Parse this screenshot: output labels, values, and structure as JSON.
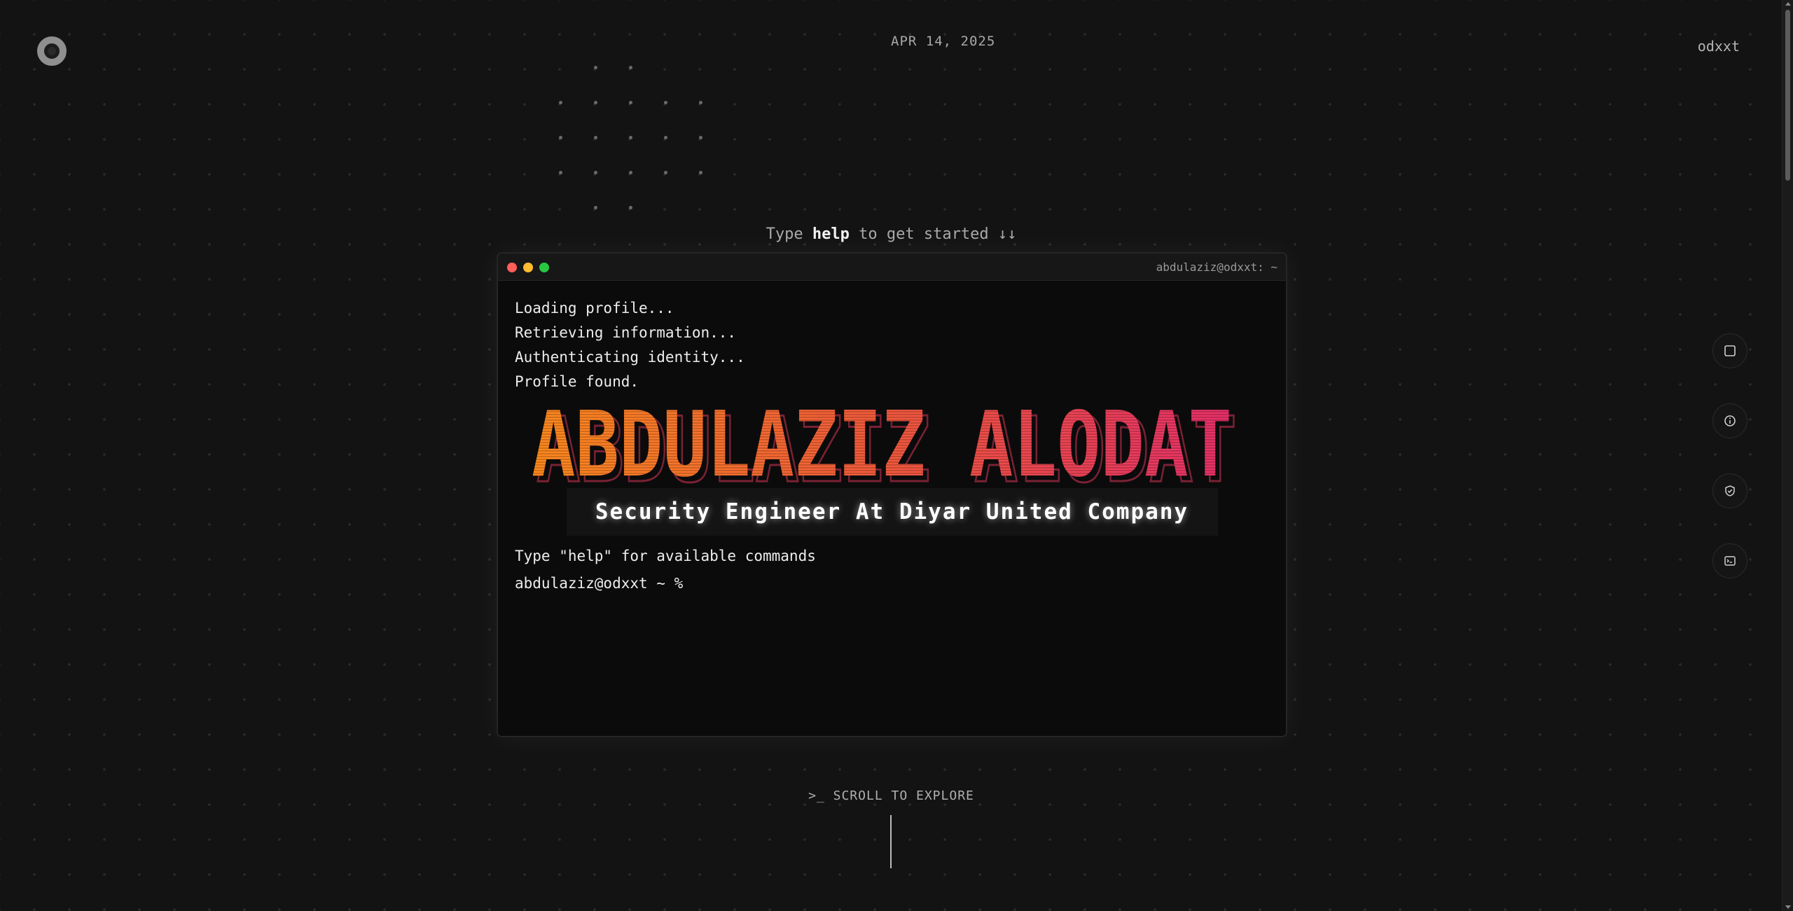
{
  "header": {
    "date": "APR 14, 2025",
    "username": "odxxt"
  },
  "hint": {
    "prefix": "Type",
    "keyword": "help",
    "suffix": "to get started ↓↓"
  },
  "terminal": {
    "title": "abdulaziz@odxxt: ~",
    "loading_lines": [
      "Loading profile...",
      "Retrieving information...",
      "Authenticating identity...",
      "Profile found."
    ],
    "banner_name": "ABDULAZIZ ALODAT",
    "subtitle": "Security Engineer At Diyar United Company",
    "help_line": "Type \"help\" for available commands",
    "prompt": "abdulaziz@odxxt ~ %"
  },
  "footer": {
    "scroll_label": ">_ SCROLL TO EXPLORE"
  },
  "side_nav": [
    {
      "icon": "square-icon"
    },
    {
      "icon": "info-icon"
    },
    {
      "icon": "shield-check-icon"
    },
    {
      "icon": "terminal-icon"
    }
  ],
  "colors": {
    "background": "#131314",
    "banner_start": "#ff8a1e",
    "banner_end": "#e8306a"
  }
}
